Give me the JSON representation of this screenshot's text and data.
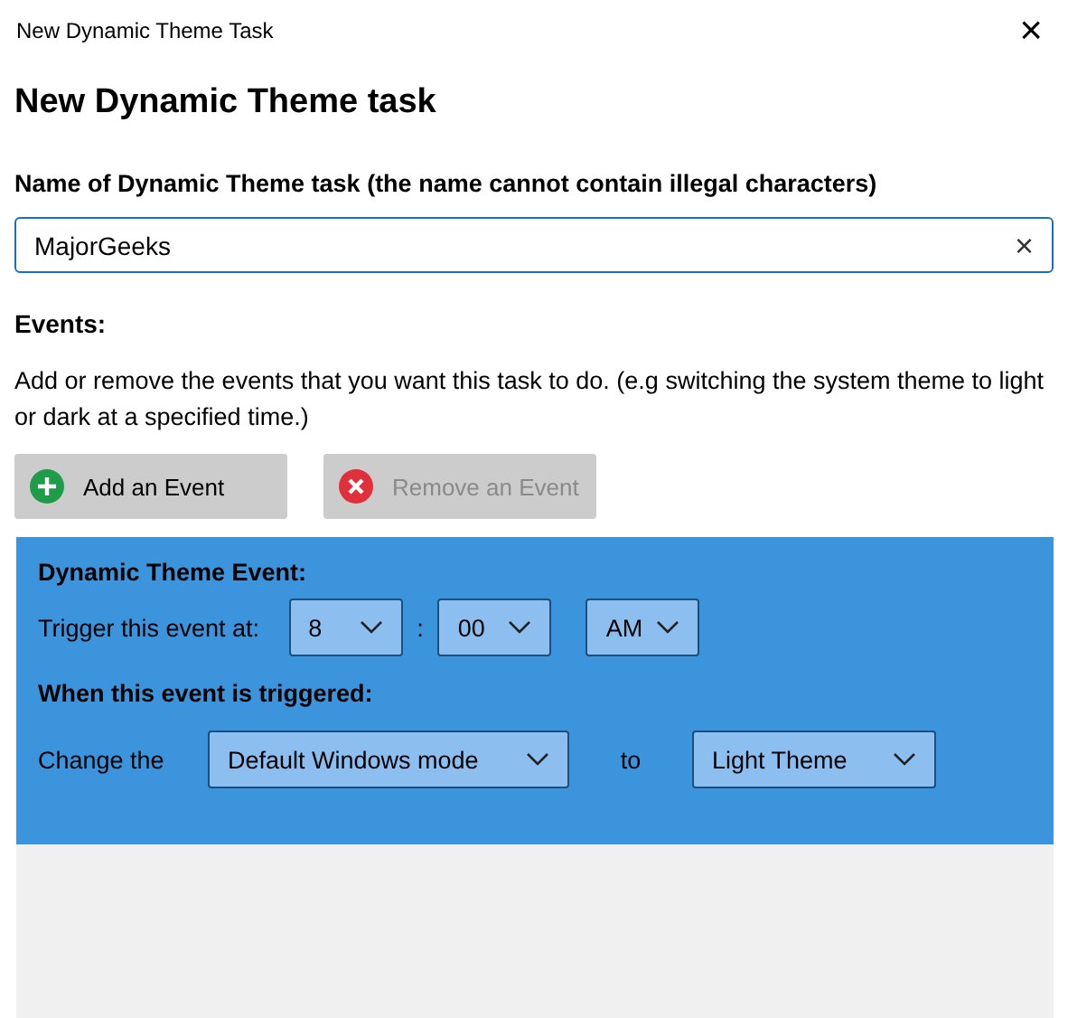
{
  "window": {
    "title": "New Dynamic Theme Task",
    "close": "×"
  },
  "heading": "New Dynamic Theme task",
  "name_field": {
    "label": "Name of Dynamic Theme task (the name cannot contain illegal characters)",
    "value": "MajorGeeks",
    "clear": "×"
  },
  "events_section": {
    "title": "Events:",
    "description": "Add or remove the events that you want this task to do. (e.g switching the system theme to light or dark at a specified time.)"
  },
  "buttons": [
    {
      "kind": "add",
      "label": "Add an Event",
      "disabled": false
    },
    {
      "kind": "remove",
      "label": "Remove an Event",
      "disabled": true
    }
  ],
  "event": {
    "title": "Dynamic Theme Event:",
    "trigger_label": "Trigger this event at:",
    "hour": "8",
    "separator": ":",
    "minute": "00",
    "period": "AM",
    "action_title": "When this event is triggered:",
    "change_label": "Change the",
    "target": "Default Windows mode",
    "to_label": "to",
    "theme": "Light Theme"
  }
}
